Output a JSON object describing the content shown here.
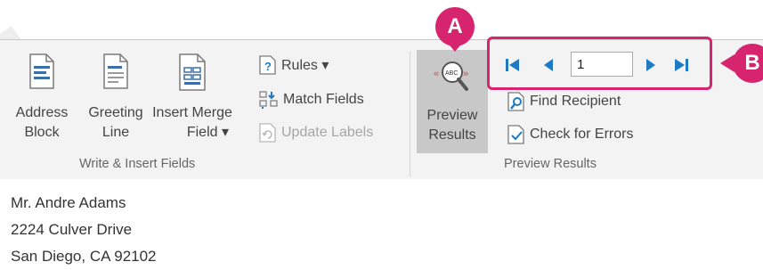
{
  "write_insert_group": {
    "label": "Write & Insert Fields",
    "address_block": {
      "line1": "Address",
      "line2": "Block"
    },
    "greeting_line": {
      "line1": "Greeting",
      "line2": "Line"
    },
    "insert_merge_field": {
      "line1": "Insert Merge",
      "line2": "Field ▾"
    },
    "rules": "Rules ▾",
    "match_fields": "Match Fields",
    "update_labels": "Update Labels"
  },
  "preview_group": {
    "label": "Preview Results",
    "preview_results": {
      "line1": "Preview",
      "line2": "Results"
    },
    "record_number": "1",
    "find_recipient": "Find Recipient",
    "check_for_errors": "Check for Errors"
  },
  "callouts": {
    "a": "A",
    "b": "B",
    "color": "#d6246e"
  },
  "document": {
    "lines": [
      "Mr. Andre Adams",
      "2224 Culver Drive",
      "San Diego, CA 92102"
    ]
  },
  "icons": {
    "first_record": "first-record-icon",
    "previous_record": "previous-record-icon",
    "next_record": "next-record-icon",
    "last_record": "last-record-icon",
    "accent": "#1e7ac2"
  }
}
